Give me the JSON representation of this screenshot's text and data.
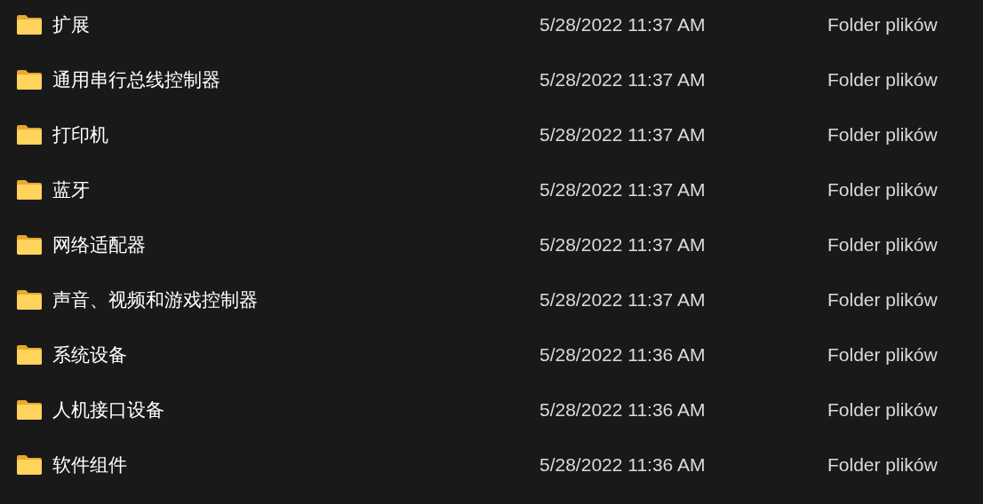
{
  "rows": [
    {
      "name": "扩展",
      "date": "5/28/2022 11:37 AM",
      "type": "Folder plików"
    },
    {
      "name": "通用串行总线控制器",
      "date": "5/28/2022 11:37 AM",
      "type": "Folder plików"
    },
    {
      "name": "打印机",
      "date": "5/28/2022 11:37 AM",
      "type": "Folder plików"
    },
    {
      "name": "蓝牙",
      "date": "5/28/2022 11:37 AM",
      "type": "Folder plików"
    },
    {
      "name": "网络适配器",
      "date": "5/28/2022 11:37 AM",
      "type": "Folder plików"
    },
    {
      "name": "声音、视频和游戏控制器",
      "date": "5/28/2022 11:37 AM",
      "type": "Folder plików"
    },
    {
      "name": "系统设备",
      "date": "5/28/2022 11:36 AM",
      "type": "Folder plików"
    },
    {
      "name": "人机接口设备",
      "date": "5/28/2022 11:36 AM",
      "type": "Folder plików"
    },
    {
      "name": "软件组件",
      "date": "5/28/2022 11:36 AM",
      "type": "Folder plików"
    }
  ]
}
